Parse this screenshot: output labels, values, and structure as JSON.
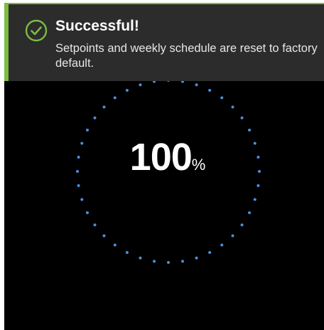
{
  "toast": {
    "title": "Successful!",
    "message": "Setpoints and weekly schedule are reset to factory default.",
    "icon": "check-circle-icon",
    "accent_color": "#7dbb42"
  },
  "progress": {
    "value": "100",
    "unit": "%",
    "fraction": 1.0,
    "ring_color": "#4a90d9"
  }
}
